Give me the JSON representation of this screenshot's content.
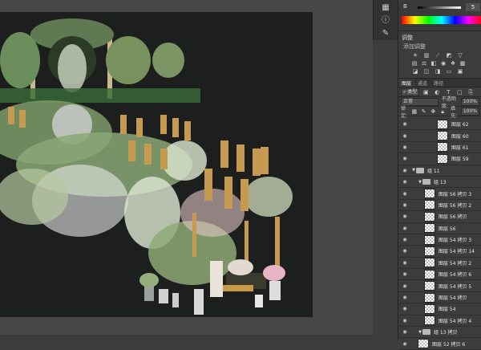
{
  "color_panel": {
    "channel_label": "B",
    "channel_value": "5"
  },
  "adjustments": {
    "title": "调整",
    "subtitle": "添加调整"
  },
  "layers_panel": {
    "tabs": [
      "图层",
      "通道",
      "路径"
    ],
    "filter_label": "类型",
    "blend_mode": "正常",
    "opacity_label": "不透明度:",
    "opacity_value": "100%",
    "lock_label": "锁定:",
    "fill_label": "填充:",
    "fill_value": "100%",
    "layers": [
      {
        "name": "图层 62",
        "kind": "layer",
        "indent": 58
      },
      {
        "name": "图层 60",
        "kind": "layer",
        "indent": 58
      },
      {
        "name": "图层 61",
        "kind": "layer",
        "indent": 58
      },
      {
        "name": "图层 59",
        "kind": "layer",
        "indent": 58
      },
      {
        "name": "组 11",
        "kind": "group",
        "indent": 26
      },
      {
        "name": "组 13",
        "kind": "group",
        "indent": 34
      },
      {
        "name": "图层 56 拷贝 3",
        "kind": "layer",
        "indent": 42
      },
      {
        "name": "图层 56 拷贝 2",
        "kind": "layer",
        "indent": 42
      },
      {
        "name": "图层 56 拷贝",
        "kind": "layer",
        "indent": 42
      },
      {
        "name": "图层 56",
        "kind": "layer",
        "indent": 42
      },
      {
        "name": "图层 54 拷贝 3",
        "kind": "layer",
        "indent": 42
      },
      {
        "name": "图层 54 拷贝 14",
        "kind": "layer",
        "indent": 42
      },
      {
        "name": "图层 54 拷贝 2",
        "kind": "layer",
        "indent": 42
      },
      {
        "name": "图层 54 拷贝 6",
        "kind": "layer",
        "indent": 42
      },
      {
        "name": "图层 54 拷贝 5",
        "kind": "layer",
        "indent": 42
      },
      {
        "name": "图层 54 拷贝",
        "kind": "layer",
        "indent": 42
      },
      {
        "name": "图层 54",
        "kind": "layer",
        "indent": 42
      },
      {
        "name": "图层 54 拷贝 4",
        "kind": "layer",
        "indent": 42
      },
      {
        "name": "组 13 拷贝",
        "kind": "group",
        "indent": 34
      },
      {
        "name": "图层 52 拷贝 6",
        "kind": "layer",
        "indent": 34
      }
    ]
  }
}
